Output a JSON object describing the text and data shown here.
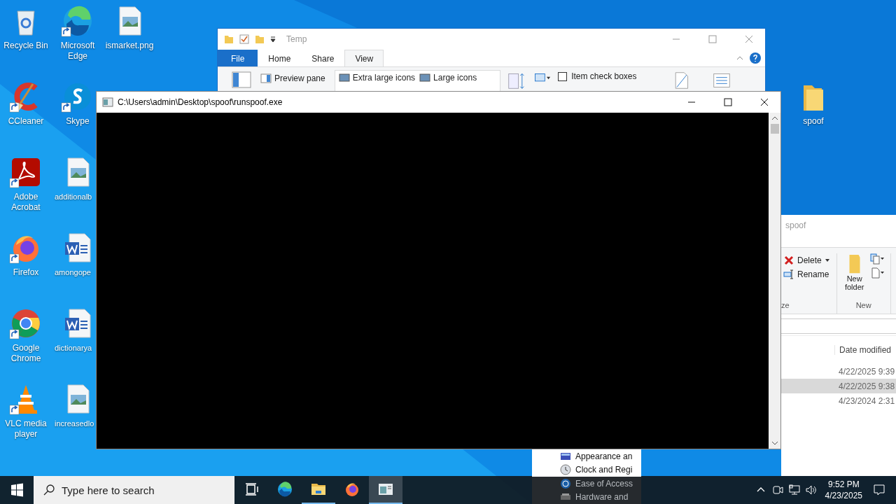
{
  "desktop_icons": [
    {
      "label": "Recycle Bin",
      "kind": "recycle",
      "shortcut": false
    },
    {
      "label": "CCleaner",
      "kind": "ccleaner",
      "shortcut": true
    },
    {
      "label": "Adobe Acrobat",
      "kind": "acrobat",
      "shortcut": true
    },
    {
      "label": "Firefox",
      "kind": "firefox",
      "shortcut": true
    },
    {
      "label": "Google Chrome",
      "kind": "chrome",
      "shortcut": true
    },
    {
      "label": "VLC media player",
      "kind": "vlc",
      "shortcut": true
    },
    {
      "label": "Microsoft Edge",
      "kind": "edge",
      "shortcut": true
    },
    {
      "label": "Skype",
      "kind": "skype",
      "shortcut": true
    },
    {
      "label": "additionalb",
      "kind": "image",
      "shortcut": false
    },
    {
      "label": "amongope",
      "kind": "word",
      "shortcut": false
    },
    {
      "label": "dictionarya",
      "kind": "word",
      "shortcut": false
    },
    {
      "label": "increasedlo",
      "kind": "image",
      "shortcut": false
    },
    {
      "label": "ismarket.png",
      "kind": "image",
      "shortcut": false
    }
  ],
  "desktop_folder": {
    "label": "spoof"
  },
  "explorer_temp": {
    "title": "Temp",
    "tabs": [
      {
        "label": "File",
        "kind": "file",
        "selected": false
      },
      {
        "label": "Home",
        "kind": "tab",
        "selected": false
      },
      {
        "label": "Share",
        "kind": "tab",
        "selected": false
      },
      {
        "label": "View",
        "kind": "tab",
        "selected": true
      }
    ],
    "preview_pane": "Preview pane",
    "layouts": [
      "Extra large icons",
      "Large icons"
    ],
    "item_check_boxes": {
      "label": "Item check boxes",
      "checked": false
    }
  },
  "explorer_spoof": {
    "title": "spoof",
    "ribbon": {
      "delete": "Delete",
      "rename": "Rename",
      "organize_group": "ze",
      "new_folder": "New folder",
      "new_group": "New"
    },
    "column": "Date modified",
    "rows": [
      {
        "date": "4/22/2025 9:39",
        "selected": false
      },
      {
        "date": "4/22/2025 9:38",
        "selected": true
      },
      {
        "date": "4/23/2024 2:31",
        "selected": false
      }
    ]
  },
  "control_panel": {
    "items": [
      {
        "label": "Appearance an",
        "kind": "appearance"
      },
      {
        "label": "Clock and Regi",
        "kind": "clock"
      },
      {
        "label": "Ease of Access",
        "kind": "ease"
      },
      {
        "label": "Hardware and",
        "kind": "hardware"
      }
    ]
  },
  "console": {
    "title": "C:\\Users\\admin\\Desktop\\spoof\\runspoof.exe"
  },
  "taskbar": {
    "search": {
      "placeholder": "Type here to search"
    },
    "apps": [
      {
        "kind": "taskview",
        "running": false,
        "selected": false
      },
      {
        "kind": "edge",
        "running": false,
        "selected": false
      },
      {
        "kind": "explorer",
        "running": true,
        "selected": false
      },
      {
        "kind": "firefox",
        "running": false,
        "selected": false
      },
      {
        "kind": "console",
        "running": true,
        "selected": true
      }
    ],
    "time": "9:52 PM",
    "date": "4/23/2025"
  }
}
